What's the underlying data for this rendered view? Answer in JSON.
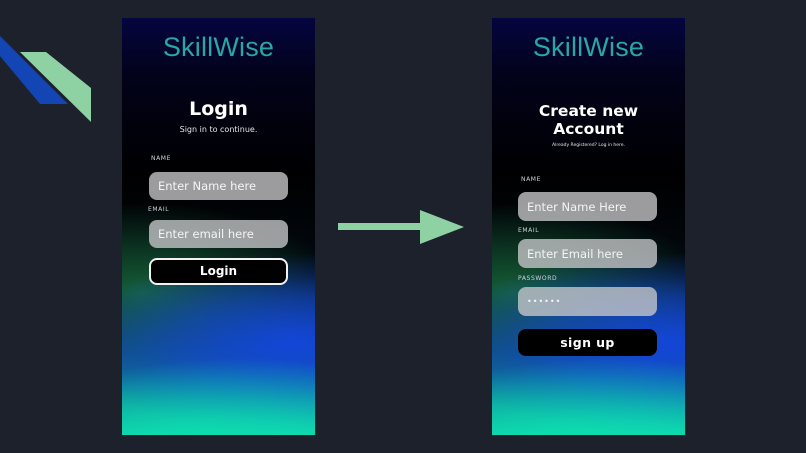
{
  "colors": {
    "page_background": "#1d212c",
    "brand_teal": "#2aa6a4",
    "accent_green": "#8ed2a4",
    "stripe_blue": "#1346b4"
  },
  "login": {
    "brand": "SkillWise",
    "title": "Login",
    "subtitle": "Sign in to continue.",
    "name_label": "NAME",
    "name_placeholder": "Enter Name here",
    "email_label": "EMAIL",
    "email_placeholder": "Enter email here",
    "button_label": "Login"
  },
  "signup": {
    "brand": "SkillWise",
    "title_line1": "Create new",
    "title_line2": "Account",
    "subtitle": "Already Registered? Log in here.",
    "name_label": "NAME",
    "name_placeholder": "Enter Name Here",
    "email_label": "EMAIL",
    "email_placeholder": "Enter Email here",
    "password_label": "PASSWORD",
    "password_value": "••••••",
    "button_label": "sign up"
  },
  "icons": {
    "decoration": "diagonal-stripes-icon",
    "flow": "arrow-right-icon"
  }
}
